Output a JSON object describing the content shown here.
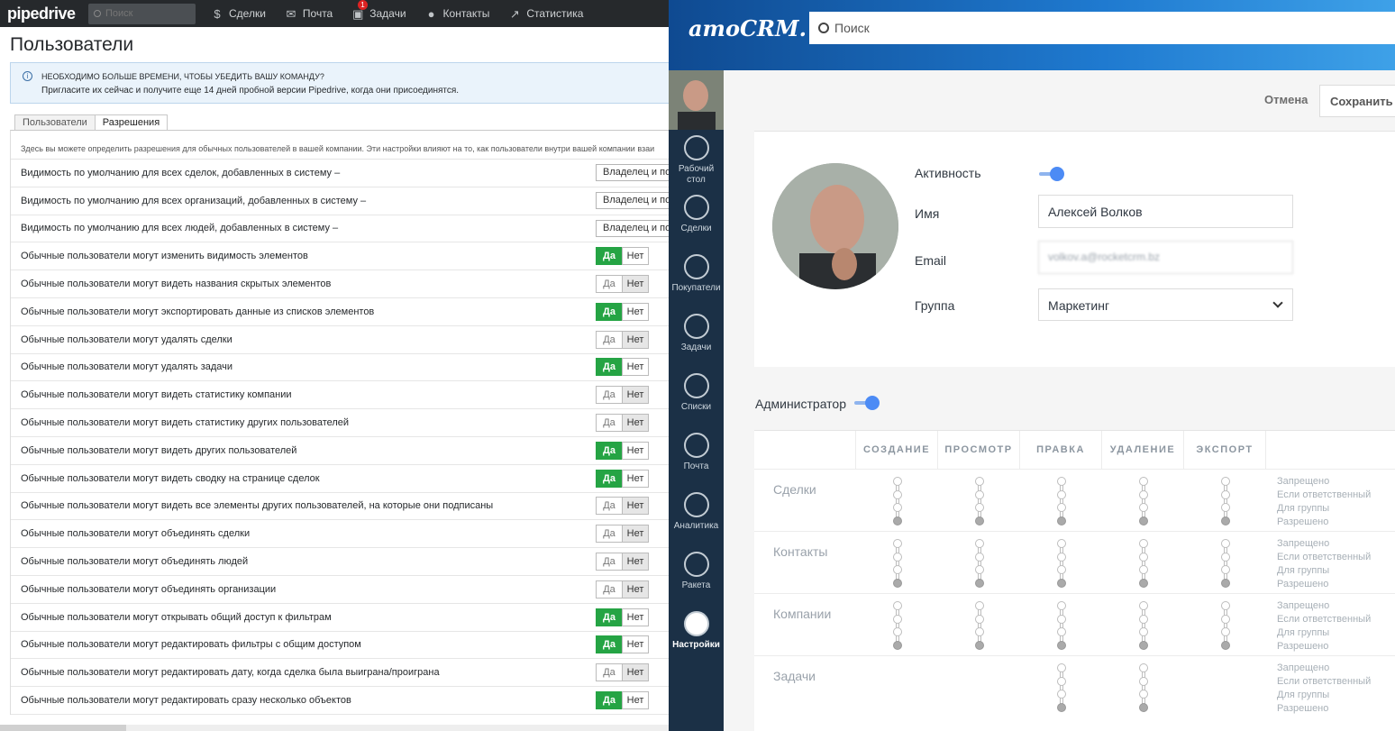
{
  "pipedrive": {
    "logo": "pipedrive",
    "search_placeholder": "Поиск",
    "nav": [
      {
        "label": "Сделки",
        "icon": "dollar-icon"
      },
      {
        "label": "Почта",
        "icon": "mail-icon"
      },
      {
        "label": "Задачи",
        "icon": "calendar-icon",
        "badge": "1"
      },
      {
        "label": "Контакты",
        "icon": "person-icon"
      },
      {
        "label": "Статистика",
        "icon": "chart-icon"
      }
    ],
    "page_title": "Пользователи",
    "alert": {
      "title": "НЕОБХОДИМО БОЛЬШЕ ВРЕМЕНИ, ЧТОБЫ УБЕДИТЬ ВАШУ КОМАНДУ?",
      "text": "Пригласите их сейчас и получите еще 14 дней пробной версии Pipedrive, когда они присоединятся."
    },
    "tabs": [
      "Пользователи",
      "Разрешения"
    ],
    "description": "Здесь вы можете определить разрешения для обычных пользователей в вашей компании. Эти настройки влияют на то, как пользователи внутри вашей компании взаи",
    "yes_label": "Да",
    "no_label": "Нет",
    "select_rows": [
      {
        "label": "Видимость по умолчанию для всех сделок, добавленных в систему –",
        "value": "Владелец и по"
      },
      {
        "label": "Видимость по умолчанию для всех организаций, добавленных в систему –",
        "value": "Владелец и по"
      },
      {
        "label": "Видимость по умолчанию для всех людей, добавленных в систему –",
        "value": "Владелец и по"
      }
    ],
    "toggle_rows": [
      {
        "label": "Обычные пользователи могут изменить видимость элементов",
        "value": "Да"
      },
      {
        "label": "Обычные пользователи могут видеть названия скрытых элементов",
        "value": "Нет"
      },
      {
        "label": "Обычные пользователи могут экспортировать данные из списков элементов",
        "value": "Да"
      },
      {
        "label": "Обычные пользователи могут удалять сделки",
        "value": "Нет"
      },
      {
        "label": "Обычные пользователи могут удалять задачи",
        "value": "Да"
      },
      {
        "label": "Обычные пользователи могут видеть статистику компании",
        "value": "Нет"
      },
      {
        "label": "Обычные пользователи могут видеть статистику других пользователей",
        "value": "Нет"
      },
      {
        "label": "Обычные пользователи могут видеть других пользователей",
        "value": "Да"
      },
      {
        "label": "Обычные пользователи могут видеть сводку на странице сделок",
        "value": "Да"
      },
      {
        "label": "Обычные пользователи могут видеть все элементы других пользователей, на которые они подписаны",
        "value": "Нет"
      },
      {
        "label": "Обычные пользователи могут объединять сделки",
        "value": "Нет"
      },
      {
        "label": "Обычные пользователи могут объединять людей",
        "value": "Нет"
      },
      {
        "label": "Обычные пользователи могут объединять организации",
        "value": "Нет"
      },
      {
        "label": "Обычные пользователи могут открывать общий доступ к фильтрам",
        "value": "Да"
      },
      {
        "label": "Обычные пользователи могут редактировать фильтры с общим доступом",
        "value": "Да"
      },
      {
        "label": "Обычные пользователи могут редактировать дату, когда сделка была выиграна/проиграна",
        "value": "Нет"
      },
      {
        "label": "Обычные пользователи могут редактировать сразу несколько объектов",
        "value": "Да"
      }
    ]
  },
  "amocrm": {
    "logo": "amoCRM.",
    "search_placeholder": "Поиск",
    "sidebar": [
      {
        "label": "Рабочий стол",
        "icon": "speedometer-icon"
      },
      {
        "label": "Сделки",
        "icon": "dollar-icon"
      },
      {
        "label": "Покупатели",
        "icon": "customers-icon"
      },
      {
        "label": "Задачи",
        "icon": "checkmark-icon"
      },
      {
        "label": "Списки",
        "icon": "list-icon"
      },
      {
        "label": "Почта",
        "icon": "mail-icon"
      },
      {
        "label": "Аналитика",
        "icon": "analytics-icon"
      },
      {
        "label": "Ракета",
        "icon": "rocket-icon"
      },
      {
        "label": "Настройки",
        "icon": "wrench-icon",
        "active": true
      }
    ],
    "cancel_label": "Отмена",
    "save_label": "Сохранить",
    "profile": {
      "active_label": "Активность",
      "active": true,
      "name_label": "Имя",
      "name_value": "Алексей Волков",
      "email_label": "Email",
      "email_value": "volkov.a@rocketcrm.bz",
      "group_label": "Группа",
      "group_value": "Маркетинг"
    },
    "admin_label": "Администратор",
    "admin": true,
    "columns": [
      "СОЗДАНИЕ",
      "ПРОСМОТР",
      "ПРАВКА",
      "УДАЛЕНИЕ",
      "ЭКСПОРТ"
    ],
    "levels": [
      "Запрещено",
      "Если ответственный",
      "Для группы",
      "Разрешено"
    ],
    "entities": [
      {
        "name": "Сделки",
        "values": [
          "Разрешено",
          "Разрешено",
          "Разрешено",
          "Разрешено",
          "Разрешено"
        ]
      },
      {
        "name": "Контакты",
        "values": [
          "Разрешено",
          "Разрешено",
          "Разрешено",
          "Разрешено",
          "Разрешено"
        ]
      },
      {
        "name": "Компании",
        "values": [
          "Разрешено",
          "Разрешено",
          "Разрешено",
          "Разрешено",
          "Разрешено"
        ]
      },
      {
        "name": "Задачи",
        "values": [
          null,
          null,
          "Разрешено",
          "Разрешено",
          null
        ]
      }
    ],
    "colors": {
      "accent": "#4c8bf5",
      "sidebar": "#1b3046",
      "pd_green": "#25a444"
    }
  }
}
